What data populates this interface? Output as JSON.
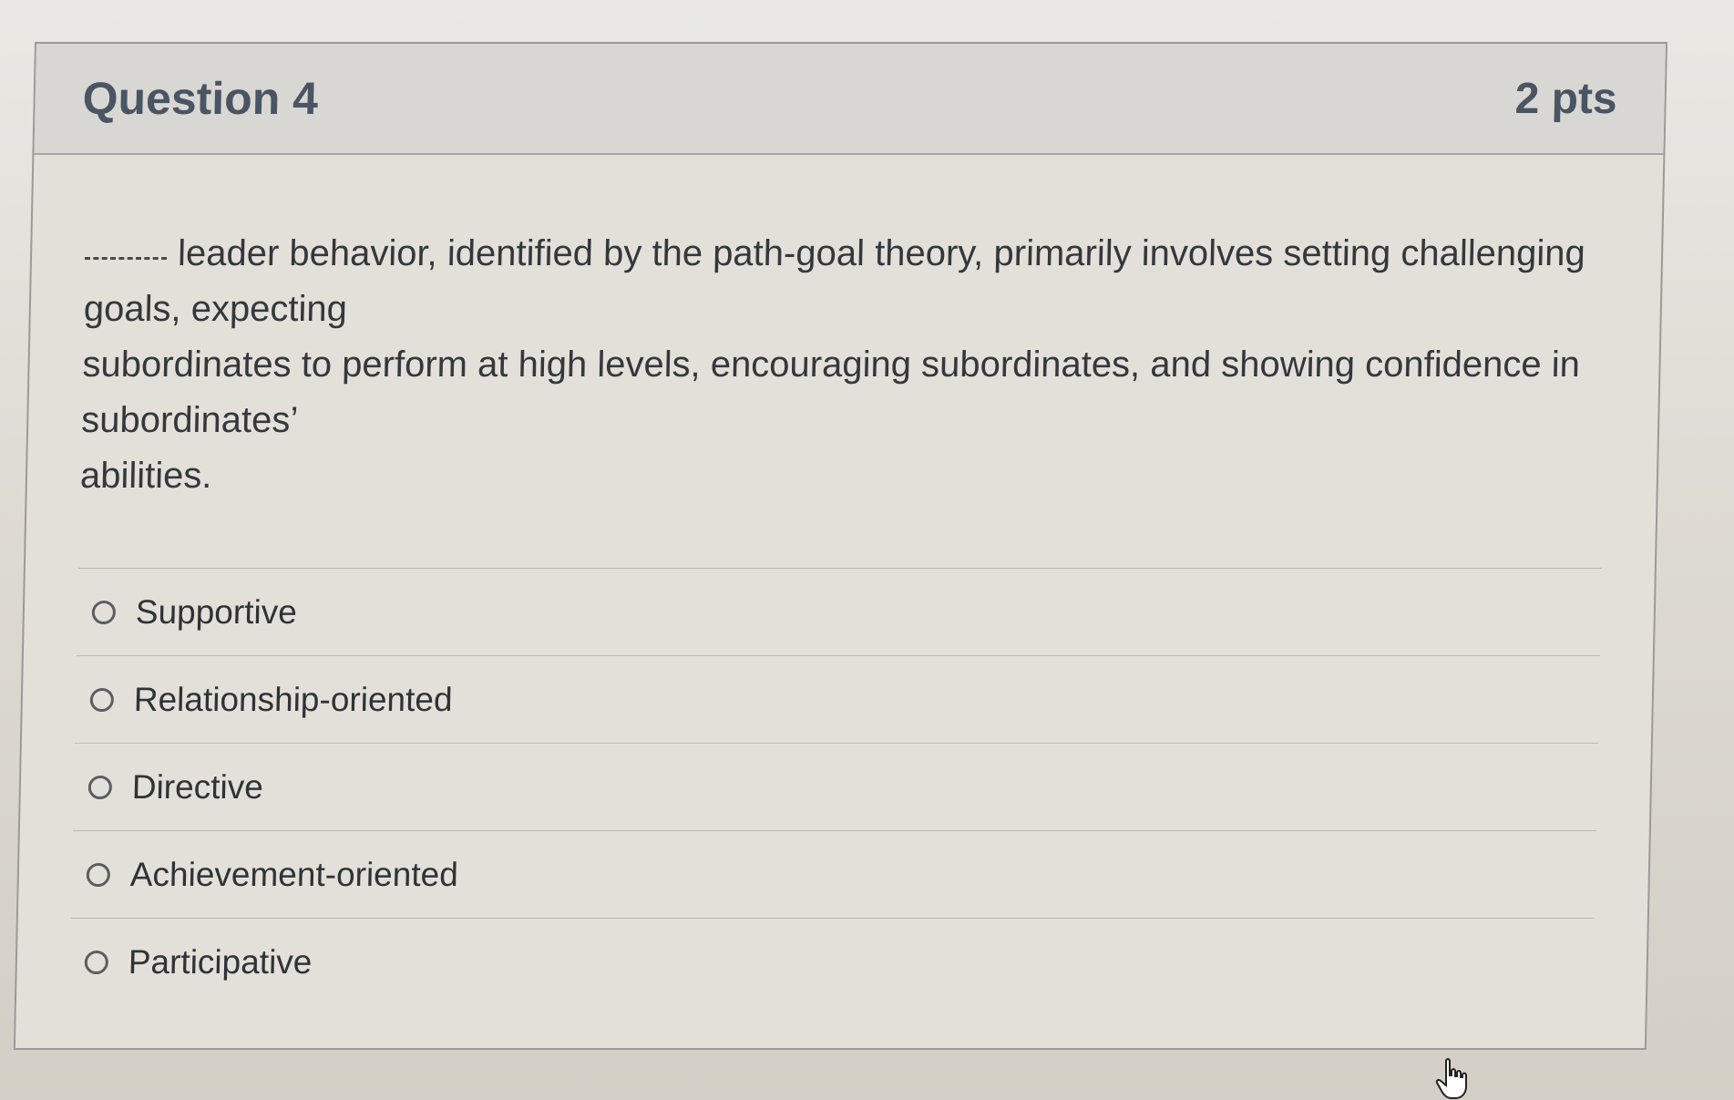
{
  "question": {
    "title": "Question 4",
    "points": "2 pts",
    "text_blank": "_____",
    "text_line1": "leader behavior, identified by the path-goal theory, primarily involves setting challenging",
    "text_line2": "goals, expecting",
    "text_line3": "subordinates to perform at high levels, encouraging subordinates, and showing confidence in",
    "text_line4": "subordinates’",
    "text_line5": "abilities."
  },
  "answers": [
    {
      "label": "Supportive",
      "selected": false
    },
    {
      "label": "Relationship-oriented",
      "selected": false
    },
    {
      "label": "Directive",
      "selected": false
    },
    {
      "label": "Achievement-oriented",
      "selected": false
    },
    {
      "label": "Participative",
      "selected": false
    }
  ],
  "cursor_icon": "hand-pointer-icon"
}
